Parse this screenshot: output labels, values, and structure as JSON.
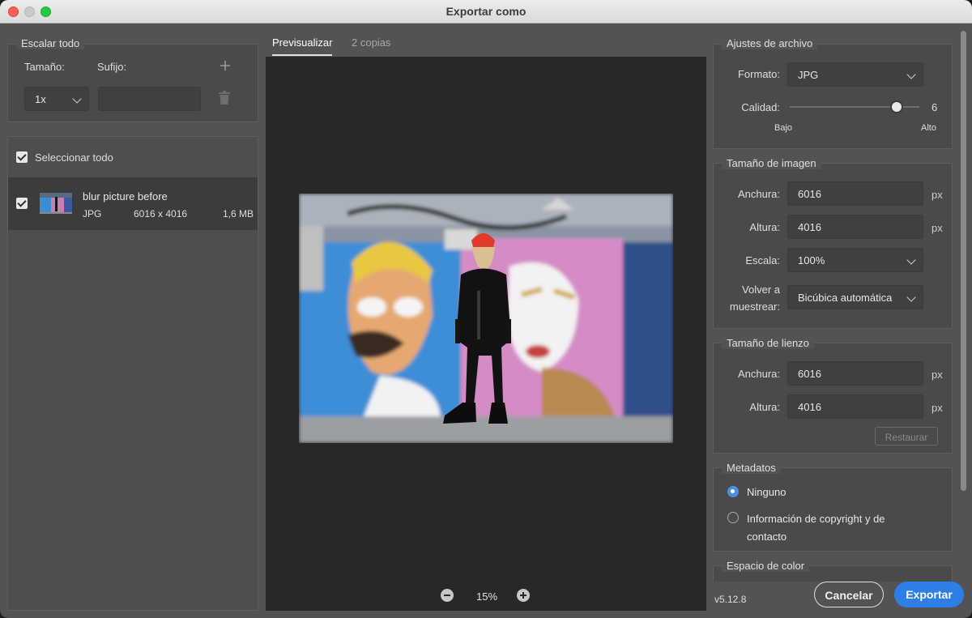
{
  "window": {
    "title": "Exportar como"
  },
  "scale_all": {
    "legend": "Escalar todo",
    "size_label": "Tamaño:",
    "suffix_label": "Sufijo:",
    "size_value": "1x",
    "suffix_value": "",
    "add_icon": "plus-icon",
    "delete_icon": "trash-icon"
  },
  "select_all": {
    "label": "Seleccionar todo",
    "checked": true
  },
  "files": [
    {
      "name": "blur picture before",
      "format": "JPG",
      "dimensions": "6016 x 4016",
      "size": "1,6 MB",
      "checked": true
    }
  ],
  "preview": {
    "tabs": [
      {
        "label": "Previsualizar",
        "active": true
      },
      {
        "label": "2 copias",
        "active": false
      }
    ],
    "zoom": "15%"
  },
  "file_settings": {
    "legend": "Ajustes de archivo",
    "format_label": "Formato:",
    "format_value": "JPG",
    "quality_label": "Calidad:",
    "quality_value": "6",
    "quality_fraction": 0.8,
    "low_label": "Bajo",
    "high_label": "Alto"
  },
  "image_size": {
    "legend": "Tamaño de imagen",
    "width_label": "Anchura:",
    "width_value": "6016",
    "height_label": "Altura:",
    "height_value": "4016",
    "scale_label": "Escala:",
    "scale_value": "100%",
    "resample_label_1": "Volver a",
    "resample_label_2": "muestrear:",
    "resample_value": "Bicúbica automática",
    "unit": "px"
  },
  "canvas_size": {
    "legend": "Tamaño de lienzo",
    "width_label": "Anchura:",
    "width_value": "6016",
    "height_label": "Altura:",
    "height_value": "4016",
    "unit": "px",
    "restore_label": "Restaurar"
  },
  "metadata": {
    "legend": "Metadatos",
    "option_none": "Ninguno",
    "option_copyright_1": "Información de copyright y de",
    "option_copyright_2": "contacto",
    "selected": "Ninguno"
  },
  "color_space": {
    "legend": "Espacio de color"
  },
  "footer": {
    "version": "v5.12.8",
    "cancel_label": "Cancelar",
    "export_label": "Exportar"
  },
  "colors": {
    "accent": "#2d7ee6",
    "radio_selected": "#4a90e2"
  }
}
